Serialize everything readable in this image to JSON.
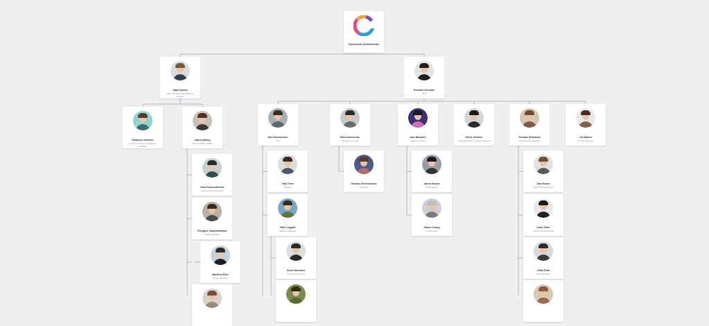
{
  "colors": {
    "background": "#efeff1",
    "card": "#ffffff",
    "connector": "#b5b5bc",
    "name_text": "#333333",
    "title_text": "#888888"
  },
  "nodes": [
    {
      "id": "root",
      "name": "Claromentis Administrator",
      "title": "",
      "type": "logo"
    },
    {
      "id": "nigel",
      "name": "Nigel Davies",
      "title": "CEO / Business Development Manager",
      "avatar": {
        "bg": "#d8dde0",
        "hair": "#7a5a3a",
        "shirt": "#2c3e50"
      }
    },
    {
      "id": "richard",
      "name": "Richard Christian",
      "title": "CTO",
      "avatar": {
        "bg": "#e3e3e3",
        "hair": "#2a1d14",
        "shirt": "#1f1f1f"
      }
    },
    {
      "id": "rosanna",
      "name": "Rosanna Johnson",
      "title": "Content Architect & Marketing Manager",
      "avatar": {
        "bg": "#8fd3d2",
        "hair": "#5a3b2a",
        "shirt": "#3b6b6a"
      }
    },
    {
      "id": "sian",
      "name": "Sian Dobbing",
      "title": "Chief Operating Officer",
      "avatar": {
        "bg": "#c9c2b3",
        "hair": "#4a3322",
        "shirt": "#3a3a3a"
      }
    },
    {
      "id": "nick",
      "name": "Nick Simmonson",
      "title": "CTO",
      "avatar": {
        "bg": "#a7b0b5",
        "hair": "#3d2b1f",
        "shirt": "#5c6770"
      }
    },
    {
      "id": "ella",
      "name": "Ella Kravchenko",
      "title": "Software QA Lead",
      "avatar": {
        "bg": "#c8c8c8",
        "hair": "#2b2b2b",
        "shirt": "#6a6a6a"
      }
    },
    {
      "id": "ivan",
      "name": "Ivan Bandaev",
      "title": "Head of Design",
      "avatar": {
        "bg": "#3a2f7a",
        "hair": "#1a1a1a",
        "shirt": "#d46fb4"
      }
    },
    {
      "id": "oliver",
      "name": "Oliver Grabner",
      "title": "Lead Developer & System Architect",
      "avatar": {
        "bg": "#d6d6d6",
        "hair": "#1a1a1a",
        "shirt": "#2a2a2a"
      }
    },
    {
      "id": "thomas",
      "name": "Thomas Shillabear",
      "title": "Development Manager",
      "avatar": {
        "bg": "#d8c6b0",
        "hair": "#6b4b32",
        "shirt": "#7a5c44"
      }
    },
    {
      "id": "uki",
      "name": "Uki Dalton",
      "title": "Product Manager",
      "avatar": {
        "bg": "#e8e8e8",
        "hair": "#4a2d1d",
        "shirt": "#8b5e46"
      }
    },
    {
      "id": "jono",
      "name": "Jono Krasnowlenski",
      "title": "Lead Content Developer",
      "avatar": {
        "bg": "#c3d2cb",
        "hair": "#2b2b2b",
        "shirt": "#2f4f4f"
      }
    },
    {
      "id": "georgios",
      "name": "Georgios Gampthatisand",
      "title": "Project Manager",
      "avatar": {
        "bg": "#b7b2a4",
        "hair": "#3a2a1a",
        "shirt": "#4d4d4d"
      }
    },
    {
      "id": "matthew",
      "name": "Matthew Park",
      "title": "Project Manager",
      "avatar": {
        "bg": "#c5d3e0",
        "hair": "#2a2a2a",
        "shirt": "#1e1e1e"
      }
    },
    {
      "id": "vlad",
      "name": "Vlad Trent",
      "title": "DevOps",
      "avatar": {
        "bg": "#dcdcdc",
        "hair": "#3a2a1a",
        "shirt": "#4a5a6a"
      }
    },
    {
      "id": "oksana",
      "name": "Oksana Goncharenko",
      "title": "QA Tester",
      "avatar": {
        "bg": "#4c5a8a",
        "hair": "#5a3a24",
        "shirt": "#b06b6b"
      }
    },
    {
      "id": "james",
      "name": "James Brown",
      "title": "UX Engineer",
      "avatar": {
        "bg": "#9aa0a6",
        "hair": "#1a1a1a",
        "shirt": "#333333"
      }
    },
    {
      "id": "dan",
      "name": "Dan Brown",
      "title": "Senior PHP Developer",
      "avatar": {
        "bg": "#e2e2e2",
        "hair": "#6b4b32",
        "shirt": "#5a5a5a"
      }
    },
    {
      "id": "mike",
      "name": "Mike Leggett",
      "title": "Test/Ops Manager",
      "avatar": {
        "bg": "#7aa6c8",
        "hair": "#3a2a1a",
        "shirt": "#5b7a3a"
      }
    },
    {
      "id": "simon",
      "name": "Simon Young",
      "title": "UX Engineer",
      "avatar": {
        "bg": "#d0d0d0",
        "hair": "#bdbdbd",
        "shirt": "#7a7a7a"
      }
    },
    {
      "id": "dmar",
      "name": "Dmar Kahn",
      "title": "Senior PHP Developer",
      "avatar": {
        "bg": "#e8e8e8",
        "hair": "#1a1a1a",
        "shirt": "#222222"
      }
    },
    {
      "id": "scott",
      "name": "Scott Saunders",
      "title": "Support Technician",
      "avatar": {
        "bg": "#dedede",
        "hair": "#2a2a2a",
        "shirt": "#2a2a2a"
      }
    },
    {
      "id": "gilad",
      "name": "Gilad Reid",
      "title": "PHP Developer",
      "avatar": {
        "bg": "#d9d9d9",
        "hair": "#2a2a2a",
        "shirt": "#3a3a3a"
      }
    },
    {
      "id": "sian_extra",
      "name": "",
      "title": "",
      "avatar": {
        "bg": "#d8d3cc",
        "hair": "#7a4b32",
        "shirt": "#9a8a7a"
      }
    },
    {
      "id": "nick_extra",
      "name": "",
      "title": "",
      "avatar": {
        "bg": "#7c8a4c",
        "hair": "#3a2a1a",
        "shirt": "#556b2f"
      }
    },
    {
      "id": "thomas_extra",
      "name": "",
      "title": "",
      "avatar": {
        "bg": "#d9c8b3",
        "hair": "#8a5a3a",
        "shirt": "#9b6b4b"
      }
    }
  ]
}
